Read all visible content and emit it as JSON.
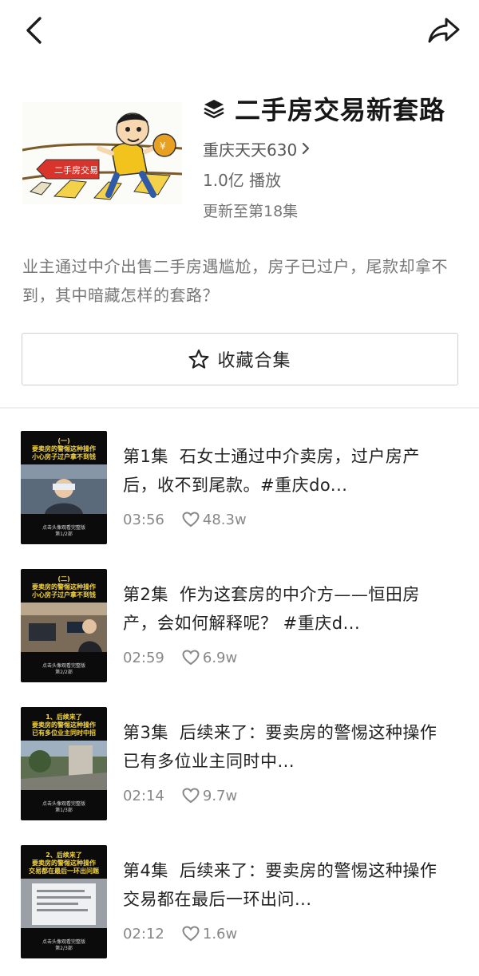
{
  "header": {
    "title": "二手房交易新套路",
    "author": "重庆天天630",
    "plays": "1.0亿 播放",
    "update": "更新至第18集",
    "cover_sign_text": "二手房交易"
  },
  "description": "业主通过中介出售二手房遇尴尬，房子已过户，尾款却拿不到，其中暗藏怎样的套路？",
  "collect_button": {
    "label": "收藏合集"
  },
  "episodes": [
    {
      "num": "第1集",
      "title": "石女士通过中介卖房，过户房产后，收不到尾款。#重庆do...",
      "duration": "03:56",
      "likes": "48.3w",
      "thumb_caption": "(一)\n要卖房的警惕这种操作\n小心房子过户拿不到钱",
      "thumb_footer": "点击头像观看完整版\n第1/2部",
      "photo_color": "#5a6a7a"
    },
    {
      "num": "第2集",
      "title": "作为这套房的中介方——恒田房产，会如何解释呢？ #重庆d...",
      "duration": "02:59",
      "likes": "6.9w",
      "thumb_caption": "(二)\n要卖房的警惕这种操作\n小心房子过户拿不到钱",
      "thumb_footer": "点击头像观看完整版\n第2/2部",
      "photo_color": "#7a6a58"
    },
    {
      "num": "第3集",
      "title": "后续来了：要卖房的警惕这种操作 已有多位业主同时中...",
      "duration": "02:14",
      "likes": "9.7w",
      "thumb_caption": "1、后续来了\n要卖房的警惕这种操作\n已有多位业主同时中招",
      "thumb_footer": "点击头像观看完整版\n第1/3部",
      "photo_color": "#5e6e50"
    },
    {
      "num": "第4集",
      "title": "后续来了：要卖房的警惕这种操作 交易都在最后一环出问...",
      "duration": "02:12",
      "likes": "1.6w",
      "thumb_caption": "2、后续来了\n要卖房的警惕这种操作\n交易都在最后一环出问题",
      "thumb_footer": "点击头像观看完整版\n第2/3部",
      "photo_color": "#9aa0a6"
    }
  ],
  "icons": {
    "back": "chevron-left-icon",
    "share": "share-arrow-icon",
    "collection": "layers-icon",
    "author_more": "chevron-right-icon",
    "collect": "star-outline-icon",
    "likes": "heart-outline-icon"
  },
  "colors": {
    "thumb_caption": "#f6d53a",
    "text_primary": "#222222",
    "text_secondary": "#777777"
  }
}
